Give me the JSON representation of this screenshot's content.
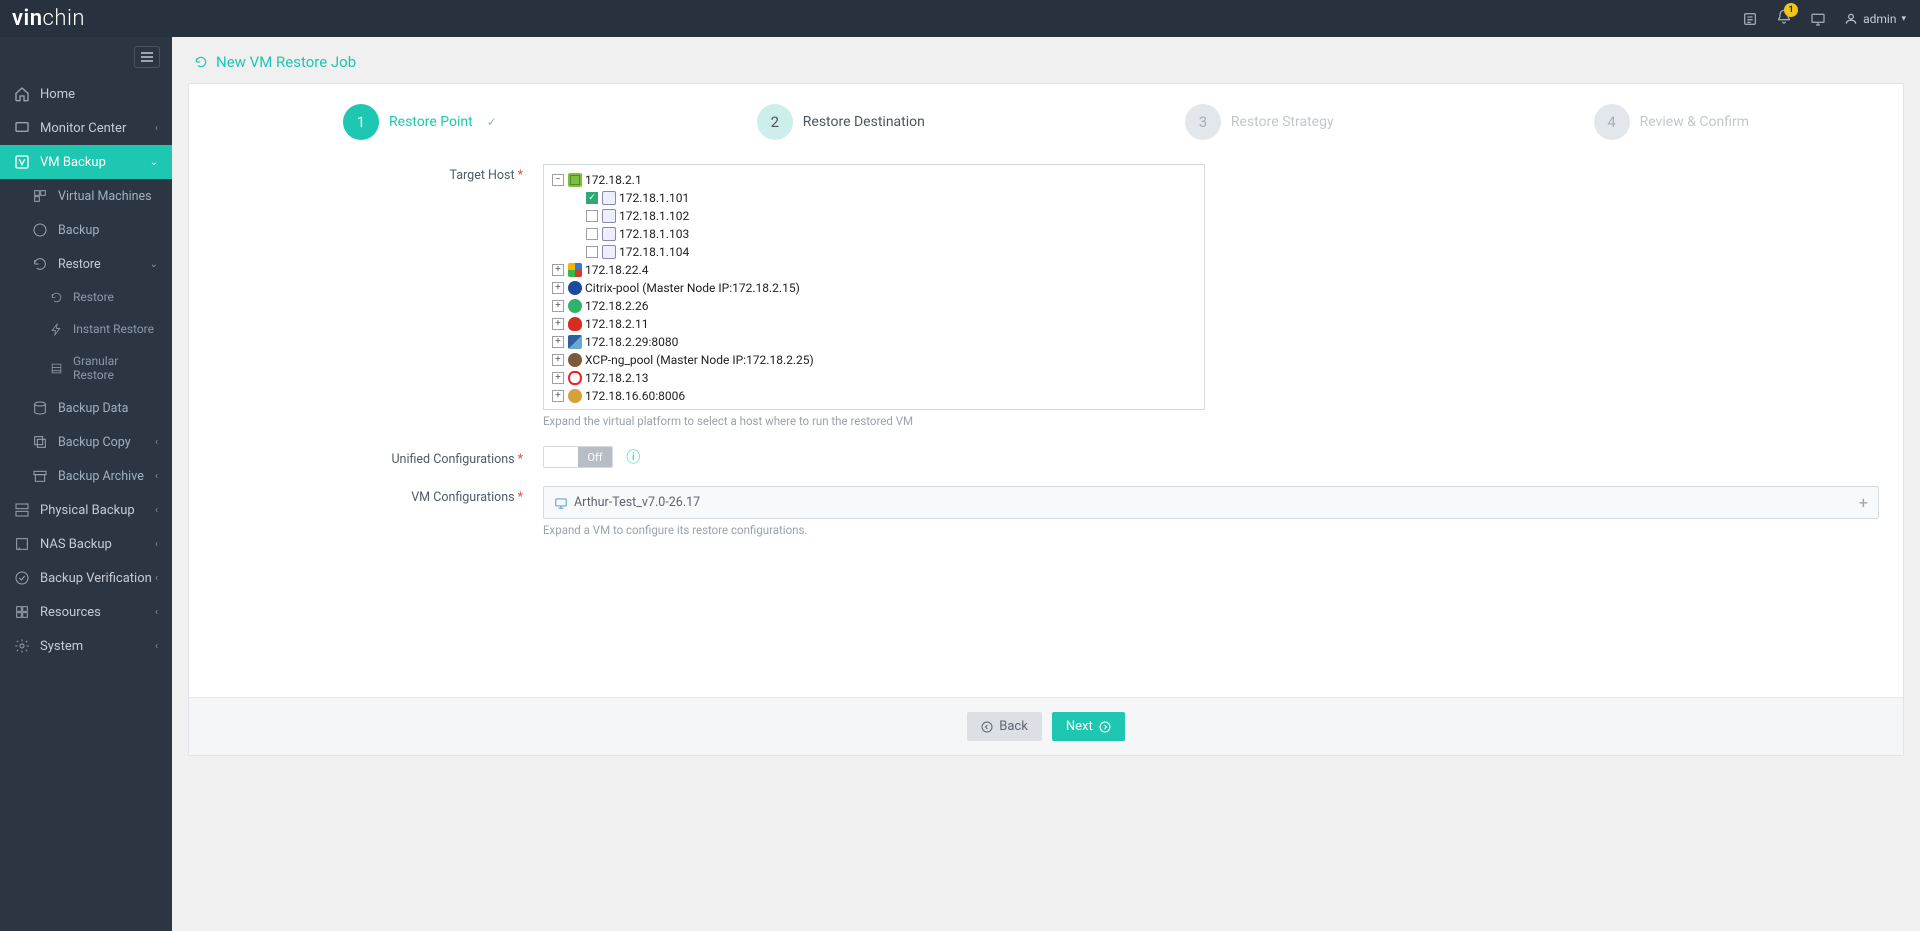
{
  "brand": {
    "part1": "vin",
    "part2": "chin"
  },
  "header": {
    "badge": "1",
    "user": "admin"
  },
  "nav": {
    "home": "Home",
    "monitor": "Monitor Center",
    "vmbackup": "VM Backup",
    "vm_machines": "Virtual Machines",
    "backup": "Backup",
    "restore_grp": "Restore",
    "restore": "Restore",
    "instant": "Instant Restore",
    "granular": "Granular Restore",
    "backup_data": "Backup Data",
    "backup_copy": "Backup Copy",
    "backup_archive": "Backup Archive",
    "physical": "Physical Backup",
    "nas": "NAS Backup",
    "verif": "Backup Verification",
    "resources": "Resources",
    "system": "System"
  },
  "page_title": "New VM Restore Job",
  "steps": {
    "s1": "Restore Point",
    "s2": "Restore Destination",
    "s3": "Restore Strategy",
    "s4": "Review & Confirm"
  },
  "labels": {
    "target_host": "Target Host",
    "unified": "Unified Configurations",
    "vm_conf": "VM Configurations"
  },
  "hints": {
    "target": "Expand the virtual platform to select a host where to run the restored VM",
    "vm": "Expand a VM to configure its restore configurations."
  },
  "switch": {
    "off": "Off"
  },
  "tree": {
    "root": "172.18.2.1",
    "children": [
      "172.18.1.101",
      "172.18.1.102",
      "172.18.1.103",
      "172.18.1.104"
    ],
    "platforms": [
      {
        "label": "172.18.22.4",
        "color1": "#2e7cd6",
        "color2": "#d13b2a",
        "color3": "#3bb44a",
        "color4": "#f5b400"
      },
      {
        "label": "Citrix-pool (Master Node IP:172.18.2.15)",
        "bg": "#1b4aa0",
        "circle": true
      },
      {
        "label": "172.18.2.26",
        "bg": "#2fb36b",
        "round": true
      },
      {
        "label": "172.18.2.11",
        "bg": "#d62d20",
        "shape": "hat"
      },
      {
        "label": "172.18.2.29:8080",
        "bg": "#2e5fa3",
        "shape": "tri"
      },
      {
        "label": "XCP-ng_pool (Master Node IP:172.18.2.25)",
        "bg": "#7a5b3a",
        "round": true
      },
      {
        "label": "172.18.2.13",
        "bg": "#e22",
        "shape": "oval"
      },
      {
        "label": "172.18.16.60:8006",
        "bg": "#d8a03a",
        "round": true
      }
    ]
  },
  "vm_config_name": "Arthur-Test_v7.0-26.17",
  "buttons": {
    "back": "Back",
    "next": "Next"
  }
}
